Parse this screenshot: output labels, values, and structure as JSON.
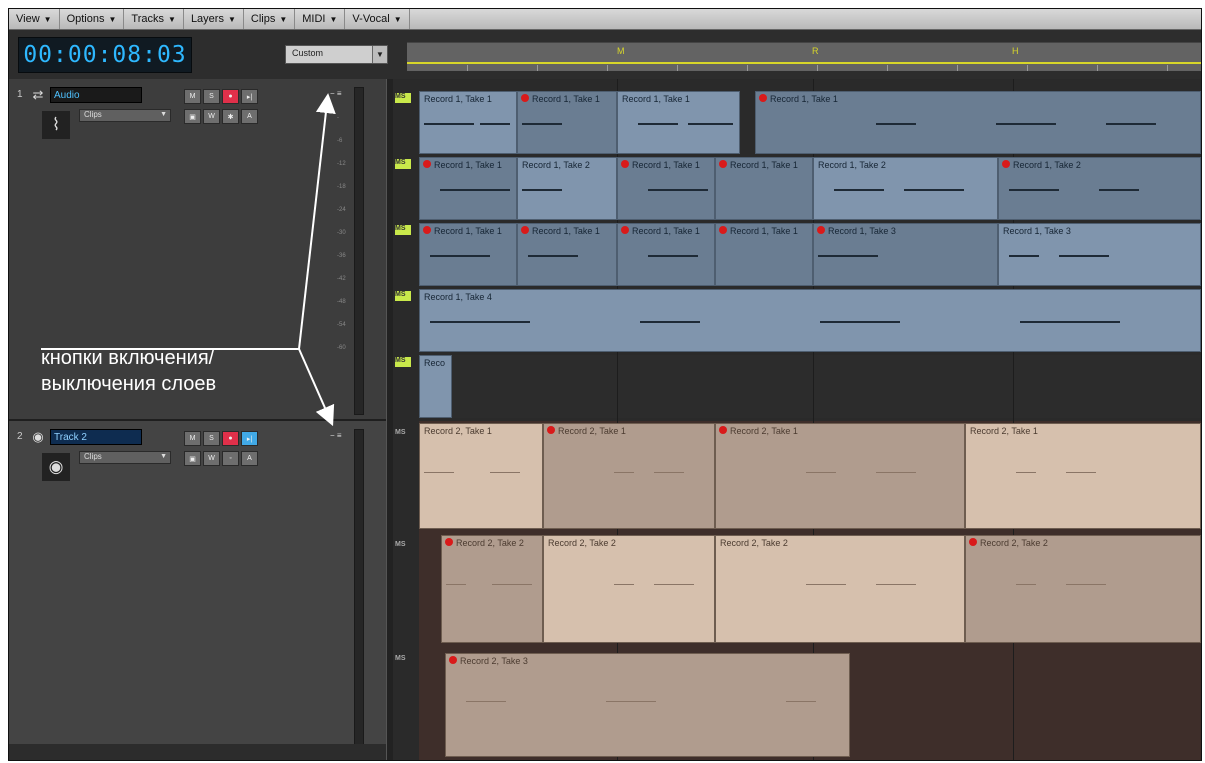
{
  "menu": [
    {
      "label": "View"
    },
    {
      "label": "Options"
    },
    {
      "label": "Tracks"
    },
    {
      "label": "Layers"
    },
    {
      "label": "Clips"
    },
    {
      "label": "MIDI"
    },
    {
      "label": "V-Vocal"
    }
  ],
  "transport": {
    "timecode": "00:00:08:03",
    "custom_label": "Custom"
  },
  "ruler": {
    "markers": [
      "M",
      "R",
      "H"
    ],
    "loop_color": "#d7d62a"
  },
  "tracks": [
    {
      "number": "1",
      "name": "Audio",
      "mode": "Clips",
      "buttons": [
        "M",
        "S",
        "R",
        "W"
      ],
      "icon": "waveform-icon",
      "name_color": "#4fc2ff"
    },
    {
      "number": "2",
      "name": "Track 2",
      "mode": "Clips",
      "buttons": [
        "M",
        "S",
        "R",
        "W"
      ],
      "icon": "midi-icon",
      "name_color": "#8fd0ff"
    }
  ],
  "annotation": {
    "text": "кнопки включения/\nвыключения слоев"
  },
  "lane_ms": "MS",
  "clips": {
    "l0": [
      "Record 1, Take 1",
      "Record 1, Take 1",
      "Record 1, Take 1",
      "Record 1, Take 1"
    ],
    "l1": [
      "Record 1, Take 1",
      "Record 1, Take 2",
      "Record 1, Take 1",
      "Record 1, Take 1",
      "Record 1, Take 2",
      "Record 1, Take 2"
    ],
    "l2": [
      "Record 1, Take 1",
      "Record 1, Take 1",
      "Record 1, Take 1",
      "Record 1, Take 1",
      "Record 1, Take 3",
      "Record 1, Take 3"
    ],
    "l3": [
      "Record 1, Take 4"
    ],
    "l4": [
      "Reco"
    ],
    "l5": [
      "Record 2, Take 1",
      "Record 2, Take 1",
      "Record 2, Take 1",
      "Record 2, Take 1"
    ],
    "l6": [
      "Record 2, Take 2",
      "Record 2, Take 2",
      "Record 2, Take 2",
      "Record 2, Take 2"
    ],
    "l7": [
      "Record 2, Take 3"
    ]
  }
}
